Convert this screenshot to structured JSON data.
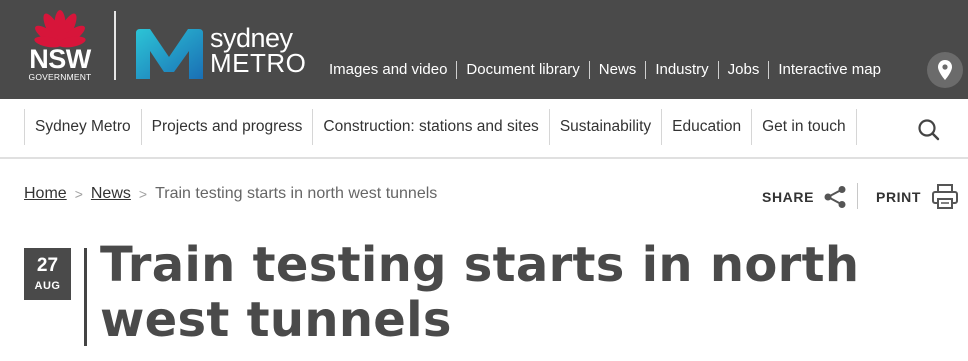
{
  "header": {
    "nsw_logo": {
      "wordmark": "NSW",
      "subtitle": "GOVERNMENT",
      "icon": "waratah-flower-icon"
    },
    "brand": {
      "line1": "sydney",
      "line2": "METRO",
      "icon": "sydney-metro-m-icon"
    },
    "utility_nav": [
      {
        "label": "Images and video"
      },
      {
        "label": "Document library"
      },
      {
        "label": "News"
      },
      {
        "label": "Industry"
      },
      {
        "label": "Jobs"
      },
      {
        "label": "Interactive map"
      }
    ],
    "map_button_icon": "map-pin-icon"
  },
  "main_nav": {
    "items": [
      {
        "label": "Sydney Metro"
      },
      {
        "label": "Projects and progress"
      },
      {
        "label": "Construction: stations and sites"
      },
      {
        "label": "Sustainability"
      },
      {
        "label": "Education"
      },
      {
        "label": "Get in touch"
      }
    ],
    "search_icon": "search-icon"
  },
  "breadcrumb": {
    "items": [
      {
        "label": "Home"
      },
      {
        "label": "News"
      }
    ],
    "separator": ">",
    "current": "Train testing starts in north west tunnels"
  },
  "tools": {
    "share_label": "SHARE",
    "share_icon": "share-icon",
    "print_label": "PRINT",
    "print_icon": "printer-icon"
  },
  "article": {
    "date_day": "27",
    "date_month": "AUG",
    "title": "Train testing starts in north west tunnels"
  },
  "colors": {
    "header_bg": "#4a4a4a",
    "waratah_red": "#d7153a",
    "metro_teal": "#21b5c8",
    "metro_blue": "#1a6fb5",
    "title_text": "#4a4a4a"
  }
}
